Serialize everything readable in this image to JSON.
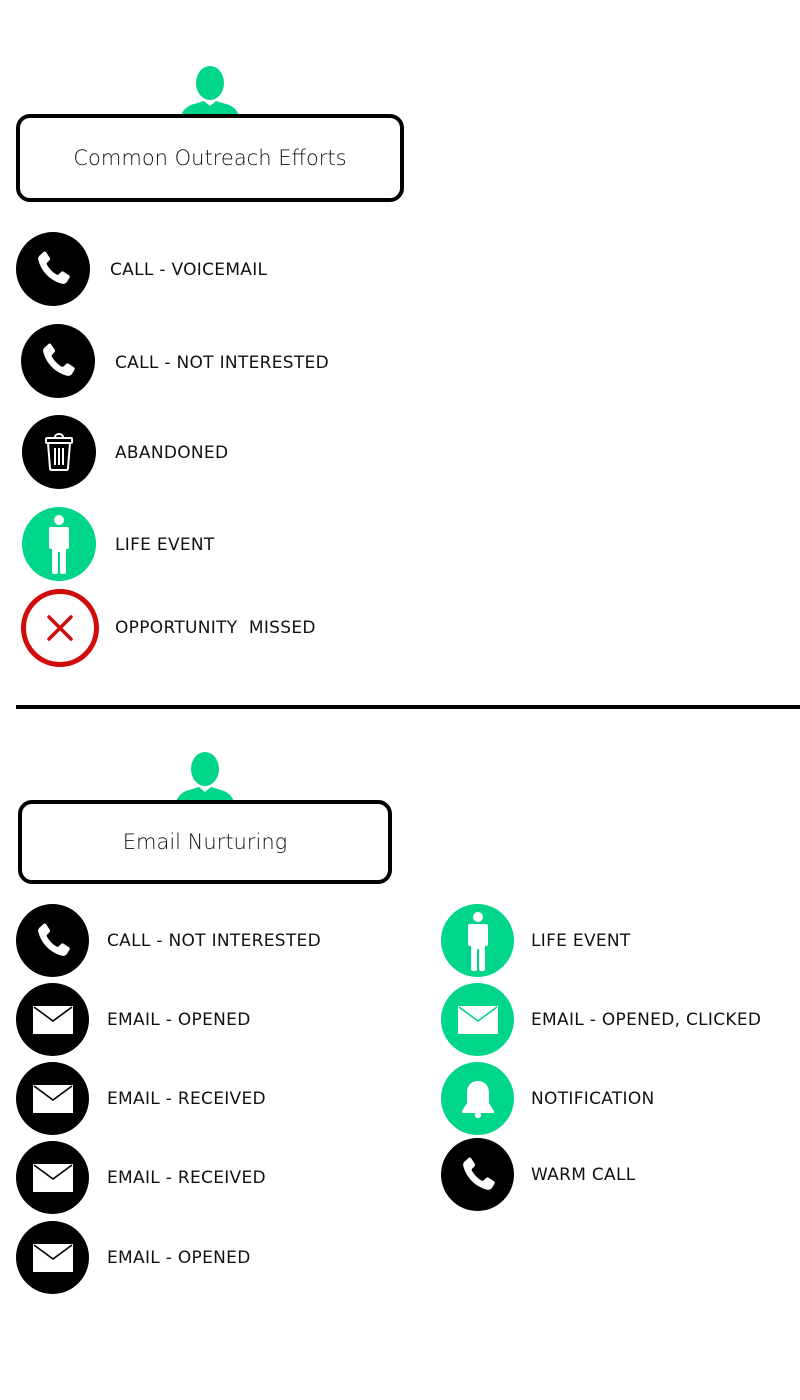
{
  "colors": {
    "accent_green": "#00d68a",
    "icon_black": "#000000",
    "missed_red": "#d10a0a",
    "text": "#111111"
  },
  "section_outreach": {
    "title": "Common Outreach Efforts",
    "badge_icon": "person-icon",
    "items": [
      {
        "label": "CALL - VOICEMAIL",
        "icon": "phone-icon",
        "style": "black"
      },
      {
        "label": "CALL - NOT INTERESTED",
        "icon": "phone-icon",
        "style": "black"
      },
      {
        "label": "ABANDONED",
        "icon": "trash-icon",
        "style": "black"
      },
      {
        "label": "LIFE EVENT",
        "icon": "standing-person-icon",
        "style": "green"
      },
      {
        "label": "OPPORTUNITY  MISSED",
        "icon": "x-close-icon",
        "style": "red-ring"
      }
    ]
  },
  "section_email": {
    "title": "Email Nurturing",
    "badge_icon": "person-icon",
    "left_items": [
      {
        "label": "CALL - NOT INTERESTED",
        "icon": "phone-icon",
        "style": "black"
      },
      {
        "label": "EMAIL - OPENED",
        "icon": "envelope-icon",
        "style": "black"
      },
      {
        "label": "EMAIL - RECEIVED",
        "icon": "envelope-icon",
        "style": "black"
      },
      {
        "label": "EMAIL - RECEIVED",
        "icon": "envelope-icon",
        "style": "black"
      },
      {
        "label": "EMAIL - OPENED",
        "icon": "envelope-icon",
        "style": "black"
      }
    ],
    "right_items": [
      {
        "label": "LIFE EVENT",
        "icon": "standing-person-icon",
        "style": "green"
      },
      {
        "label": "EMAIL - OPENED, CLICKED",
        "icon": "envelope-icon",
        "style": "green"
      },
      {
        "label": "NOTIFICATION",
        "icon": "bell-icon",
        "style": "green"
      },
      {
        "label": "WARM CALL",
        "icon": "phone-icon",
        "style": "black"
      }
    ]
  }
}
